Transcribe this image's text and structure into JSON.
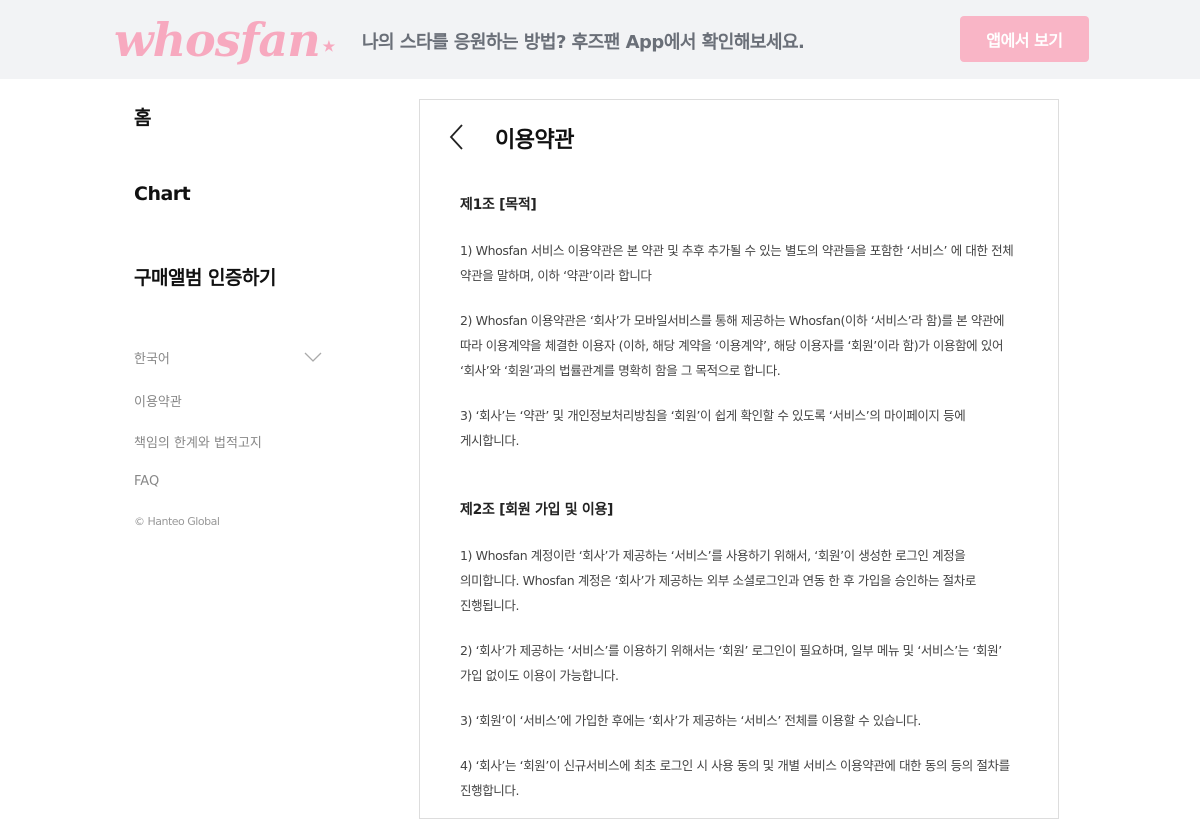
{
  "banner": {
    "logo_text": "whosfan",
    "logo_star": "★",
    "message": "나의 스타를 응원하는 방법? 후즈팬 App에서 확인해보세요.",
    "button_label": "앱에서 보기",
    "colors": {
      "background": "#f2f3f5",
      "accent": "#f9b5c6"
    }
  },
  "sidebar": {
    "main_items": [
      {
        "label": "홈"
      },
      {
        "label": "Chart"
      },
      {
        "label": "구매앨범 인증하기"
      }
    ],
    "language": {
      "selected": "한국어",
      "icon": "chevron-down-icon"
    },
    "sub_items": [
      {
        "label": "이용약관"
      },
      {
        "label": "책임의 한계와 법적고지"
      },
      {
        "label": "FAQ"
      }
    ],
    "copyright": "© Hanteo Global"
  },
  "main": {
    "back_icon": "chevron-left-icon",
    "title": "이용약관",
    "sections": [
      {
        "title": "제1조 [목적]",
        "paragraphs": [
          "1) Whosfan 서비스 이용약관은 본 약관 및 추후 추가될 수 있는 별도의 약관들을 포함한 ‘서비스’ 에 대한 전체 약관을 말하며, 이하 ‘약관’이라 합니다",
          "2) Whosfan 이용약관은 ‘회사’가 모바일서비스를 통해 제공하는 Whosfan(이하 ‘서비스’라 함)를 본 약관에 따라 이용계약을 체결한 이용자 (이하, 해당 계약을 ‘이용계약’, 해당 이용자를 ‘회원’이라 함)가 이용함에 있어 ‘회사’와 ‘회원’과의 법률관계를 명확히 함을 그 목적으로 합니다.",
          "3) ‘회사’는 ‘약관’ 및 개인정보처리방침을 ‘회원’이 쉽게 확인할 수 있도록 ‘서비스’의 마이페이지 등에 게시합니다."
        ]
      },
      {
        "title": "제2조 [회원 가입 및 이용]",
        "paragraphs": [
          "1) Whosfan 계정이란 ‘회사’가 제공하는 ‘서비스’를 사용하기 위해서, ‘회원’이 생성한 로그인 계정을 의미합니다. Whosfan 계정은 ‘회사’가 제공하는 외부 소셜로그인과 연동 한 후 가입을 승인하는 절차로 진행됩니다.",
          "2) ‘회사’가 제공하는 ‘서비스’를 이용하기 위해서는 ‘회원’ 로그인이 필요하며, 일부 메뉴 및 ‘서비스’는 ‘회원’ 가입 없이도 이용이 가능합니다.",
          "3) ‘회원’이 ‘서비스’에 가입한 후에는 ‘회사’가 제공하는 ‘서비스’ 전체를 이용할 수 있습니다.",
          "4) ‘회사’는 ‘회원’이 신규서비스에 최초 로그인 시 사용 동의 및 개별 서비스 이용약관에 대한 동의 등의 절차를 진행합니다."
        ]
      }
    ]
  }
}
